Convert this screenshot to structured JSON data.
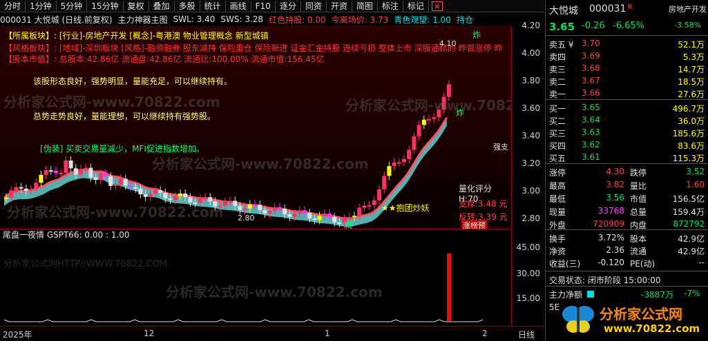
{
  "toolbar": {
    "items": [
      "000031 大悦城 (日线,前复权)",
      "主力神器主图",
      "复权",
      "叠加",
      "多股",
      "统计",
      "画线",
      "F10",
      "逐分",
      "同资",
      "开资",
      "简图",
      "标注",
      "标记",
      "标记"
    ],
    "periods": [
      "分时",
      "1分钟",
      "5分钟",
      "15分钟"
    ],
    "tools": [
      "复权",
      "叠加",
      "多股",
      "统计",
      "画线",
      "F10",
      "逐分",
      "同资",
      "开资",
      "简图",
      "标注",
      "标记"
    ],
    "stock": "000031 大悦城 (日线.前复权)",
    "indicator": "主力神器主图",
    "close_label": "×"
  },
  "title_row": {
    "swl_label": "SWL: 3.40",
    "sws_label": "SWS: 3.28",
    "red_hold": "红色持股: 0.00",
    "today_price": "今离场价: 3.73",
    "green_watch": "青色观望: 1.00",
    "extra": "持仓"
  },
  "info": {
    "sector": "【所属板块】: [行业]-房地产开发 [概念]-粤港澳 物业管理概念 新型城镇",
    "style": "【风格板块】: [地域]-深圳板块 [风格]-融资融券 股东减持 保险重仓 保险新进 证金汇金持股 连续亏损 整体上市 深股通标的 昨曾涨停 昨",
    "cap": "【股本市值】: 总股本:42.86亿 流通盘:42.86亿 流通比:100.00% 流通市值:156.45亿"
  },
  "messages": {
    "m1": "该股形态良好，强势明显，量能充足，可以继续持有。",
    "m2": "总势走势良好，量能理想，可以继续持有强势股。",
    "m3": "[伪装] 买卖交易量减少，MFI促进指数增加。"
  },
  "annotations": {
    "high": "4.10",
    "low": "2.80",
    "strong": "强支",
    "score": "量化评分H:70",
    "support": "支撑:3.48 元",
    "reversal": "反转:3.39 元",
    "limit_up_prediction": "涨榜预",
    "hug": "★★抱团炒妖",
    "reduce": "减",
    "bomb1": "炸",
    "bomb2": "炸"
  },
  "y_axis": [
    "4.20",
    "4.00",
    "3.80",
    "3.60",
    "3.40",
    "3.20",
    "3.00",
    "2.80"
  ],
  "sub": {
    "title": "尾盘一夜情 GSPT66: 0.00 : 1.00",
    "watermark": "分析家公式网HTTP//WWW.70822.COM",
    "y_axis": [
      "45.00",
      "30.00",
      "15.00"
    ]
  },
  "x_axis": {
    "labels": [
      "2025年",
      "12",
      "1",
      "2"
    ],
    "right_label": "日线"
  },
  "watermarks": [
    "分析家公式网-www.70822.com"
  ],
  "quote": {
    "name": "大悦城",
    "code": "000031",
    "flag": "R",
    "sector": "房地产开发",
    "sector_change": "-3.58%",
    "price": "3.65",
    "change": "-0.26",
    "pct": "-6.65%",
    "asks": [
      {
        "label": "卖五 ¥",
        "price": "3.70",
        "vol": "52.1万"
      },
      {
        "label": "卖四",
        "price": "3.69",
        "vol": "5.3万"
      },
      {
        "label": "卖三",
        "price": "3.68",
        "vol": "14.7万"
      },
      {
        "label": "卖二",
        "price": "3.67",
        "vol": "18.5万"
      },
      {
        "label": "卖一",
        "price": "3.66",
        "vol": "27.6万"
      }
    ],
    "bids": [
      {
        "label": "买一",
        "price": "3.65",
        "vol": "496.7万"
      },
      {
        "label": "买二",
        "price": "3.64",
        "vol": "36.0万"
      },
      {
        "label": "买三",
        "price": "3.63",
        "vol": "185.6万"
      },
      {
        "label": "买四",
        "price": "3.62",
        "vol": "83.6万"
      },
      {
        "label": "买五",
        "price": "3.61",
        "vol": "115.3万"
      }
    ],
    "stats": [
      {
        "l1": "涨停",
        "v1": "4.30",
        "c1": "red",
        "l2": "跌停",
        "v2": "3.52",
        "c2": "green"
      },
      {
        "l1": "最高",
        "v1": "3.82",
        "c1": "red",
        "l2": "量比",
        "v2": "1.60",
        "c2": "red"
      },
      {
        "l1": "最低",
        "v1": "3.56",
        "c1": "green",
        "l2": "市值",
        "v2": "156.5亿",
        "c2": "white"
      },
      {
        "l1": "现量",
        "v1": "33768",
        "c1": "magenta",
        "l2": "总量",
        "v2": "159.4万",
        "c2": "white"
      },
      {
        "l1": "外盘",
        "v1": "720909",
        "c1": "red",
        "l2": "内盘",
        "v2": "872792",
        "c2": "green"
      }
    ],
    "stats2": [
      {
        "l1": "换手",
        "v1": "3.72%",
        "l2": "股本",
        "v2": "42.9亿"
      },
      {
        "l1": "净资",
        "v1": "2.36",
        "l2": "流通",
        "v2": "42.9亿"
      },
      {
        "l1": "收益(三)",
        "v1": "-0.120",
        "l2": "PE(动)",
        "v2": "--"
      }
    ],
    "trade_status": "交易状态: 闭市阶段 15:00:00",
    "net_label": "主力净额",
    "net_value": "-3887万",
    "net_pct": "-7%",
    "period": "5E",
    "brand": "分析家公式网",
    "brand_url": "www.70822.com"
  },
  "colors": {
    "up": "#ff3030",
    "down": "#00e0e0",
    "ma_red": "#ff4040",
    "ma_cyan": "#40e0e0"
  }
}
